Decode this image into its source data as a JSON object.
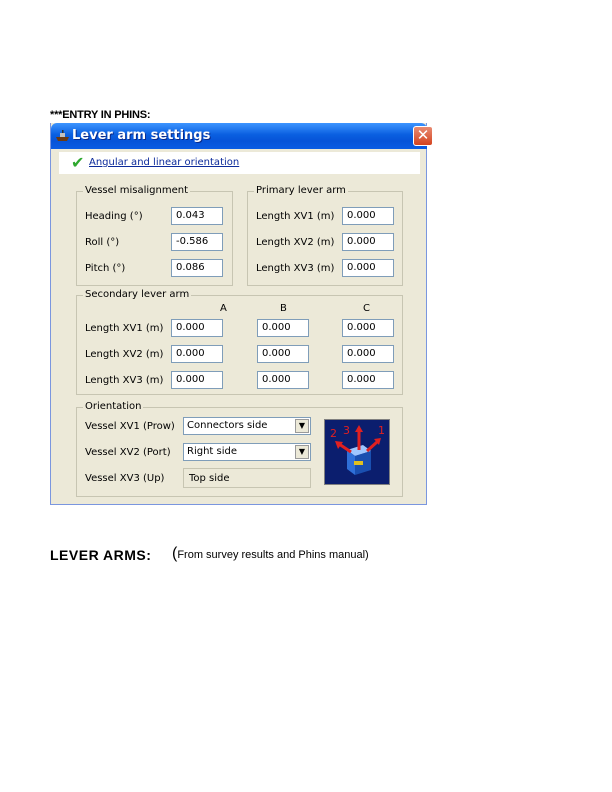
{
  "page": {
    "entry_heading": "***ENTRY IN PHINS:",
    "lever_arms_heading": "LEVER ARMS:",
    "lever_arms_paren": "(",
    "lever_arms_note": "From survey results and Phins manual)"
  },
  "window": {
    "title": "Lever arm settings",
    "close_glyph": "✕",
    "tab": {
      "check_glyph": "✔",
      "label": "Angular and linear orientation"
    }
  },
  "vessel_misalignment": {
    "title": "Vessel misalignment",
    "rows": [
      {
        "label": "Heading (°)",
        "value": "0.043"
      },
      {
        "label": "Roll (°)",
        "value": "-0.586"
      },
      {
        "label": "Pitch (°)",
        "value": "0.086"
      }
    ]
  },
  "primary_lever_arm": {
    "title": "Primary lever arm",
    "rows": [
      {
        "label": "Length XV1 (m)",
        "value": "0.000"
      },
      {
        "label": "Length XV2 (m)",
        "value": "0.000"
      },
      {
        "label": "Length XV3 (m)",
        "value": "0.000"
      }
    ]
  },
  "secondary_lever_arm": {
    "title": "Secondary lever arm",
    "columns": [
      "A",
      "B",
      "C"
    ],
    "rows": [
      {
        "label": "Length XV1 (m)",
        "values": [
          "0.000",
          "0.000",
          "0.000"
        ]
      },
      {
        "label": "Length XV2 (m)",
        "values": [
          "0.000",
          "0.000",
          "0.000"
        ]
      },
      {
        "label": "Length XV3 (m)",
        "values": [
          "0.000",
          "0.000",
          "0.000"
        ]
      }
    ]
  },
  "orientation": {
    "title": "Orientation",
    "xv1": {
      "label": "Vessel XV1 (Prow)",
      "value": "Connectors side"
    },
    "xv2": {
      "label": "Vessel XV2 (Port)",
      "value": "Right side"
    },
    "xv3": {
      "label": "Vessel XV3 (Up)",
      "value": "Top side"
    },
    "dropdown_glyph": "▼",
    "image_digits": [
      "2",
      "3",
      "1"
    ]
  },
  "colors": {
    "title_bar": "#0a5fe0",
    "dialog_bg": "#ece9d8",
    "close": "#d4431f",
    "check": "#2fa82f",
    "link": "#0c2a9a"
  }
}
